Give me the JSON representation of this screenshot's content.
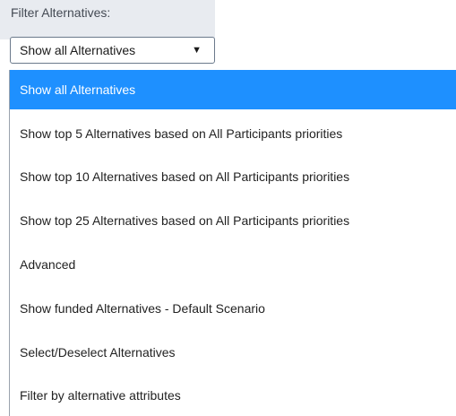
{
  "filter": {
    "label": "Filter Alternatives:",
    "selected_value": "Show all Alternatives",
    "arrow_glyph": "▼"
  },
  "dropdown": {
    "options": [
      {
        "label": "Show all Alternatives",
        "selected": true
      },
      {
        "label": "Show top 5 Alternatives based on All Participants priorities",
        "selected": false
      },
      {
        "label": "Show top 10 Alternatives based on All Participants priorities",
        "selected": false
      },
      {
        "label": "Show top 25 Alternatives based on All Participants priorities",
        "selected": false
      },
      {
        "label": "Advanced",
        "selected": false
      },
      {
        "label": "Show funded Alternatives - Default Scenario",
        "selected": false
      },
      {
        "label": "Select/Deselect Alternatives",
        "selected": false
      },
      {
        "label": "Filter by alternative attributes",
        "selected": false
      }
    ]
  },
  "colors": {
    "selected_background": "#1e90ff",
    "selected_text": "#ffffff",
    "header_background": "#e8ebf0"
  }
}
